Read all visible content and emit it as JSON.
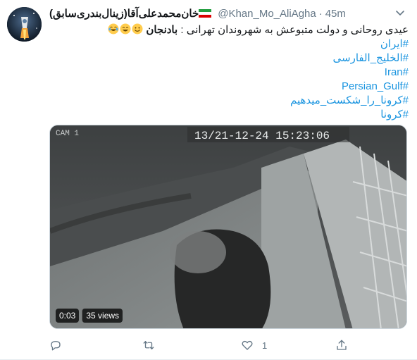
{
  "tweet": {
    "display_name": "خان‌محمدعلی‌آقا(زینال‌بندری‌سابق)",
    "handle": "@Khan_Mo_AliAgha",
    "separator": "·",
    "time": "45m",
    "text_main": "عیدی روحانی و دولت متبوعش به شهروندان تهرانی : ",
    "text_bold": "بادنجان",
    "emojis": [
      "laughing-face-icon",
      "grinning-face-icon",
      "smiling-face-icon"
    ],
    "hashtags": [
      "#ایران",
      "#الخلیج_الفارسی",
      "#Iran",
      "#Persian_Gulf",
      "#کرونا_را_شکست_میدهیم",
      "#کرونا"
    ]
  },
  "video": {
    "overlay_timestamp": "13/21-12-24  15:23:06",
    "overlay_corner": "CAM 1",
    "duration": "0:03",
    "views": "35 views"
  },
  "actions": {
    "reply_count": "",
    "retweet_count": "",
    "like_count": "1",
    "share_count": ""
  },
  "colors": {
    "link": "#1b95e0",
    "secondary_text": "#657786",
    "primary_text": "#14171a"
  }
}
